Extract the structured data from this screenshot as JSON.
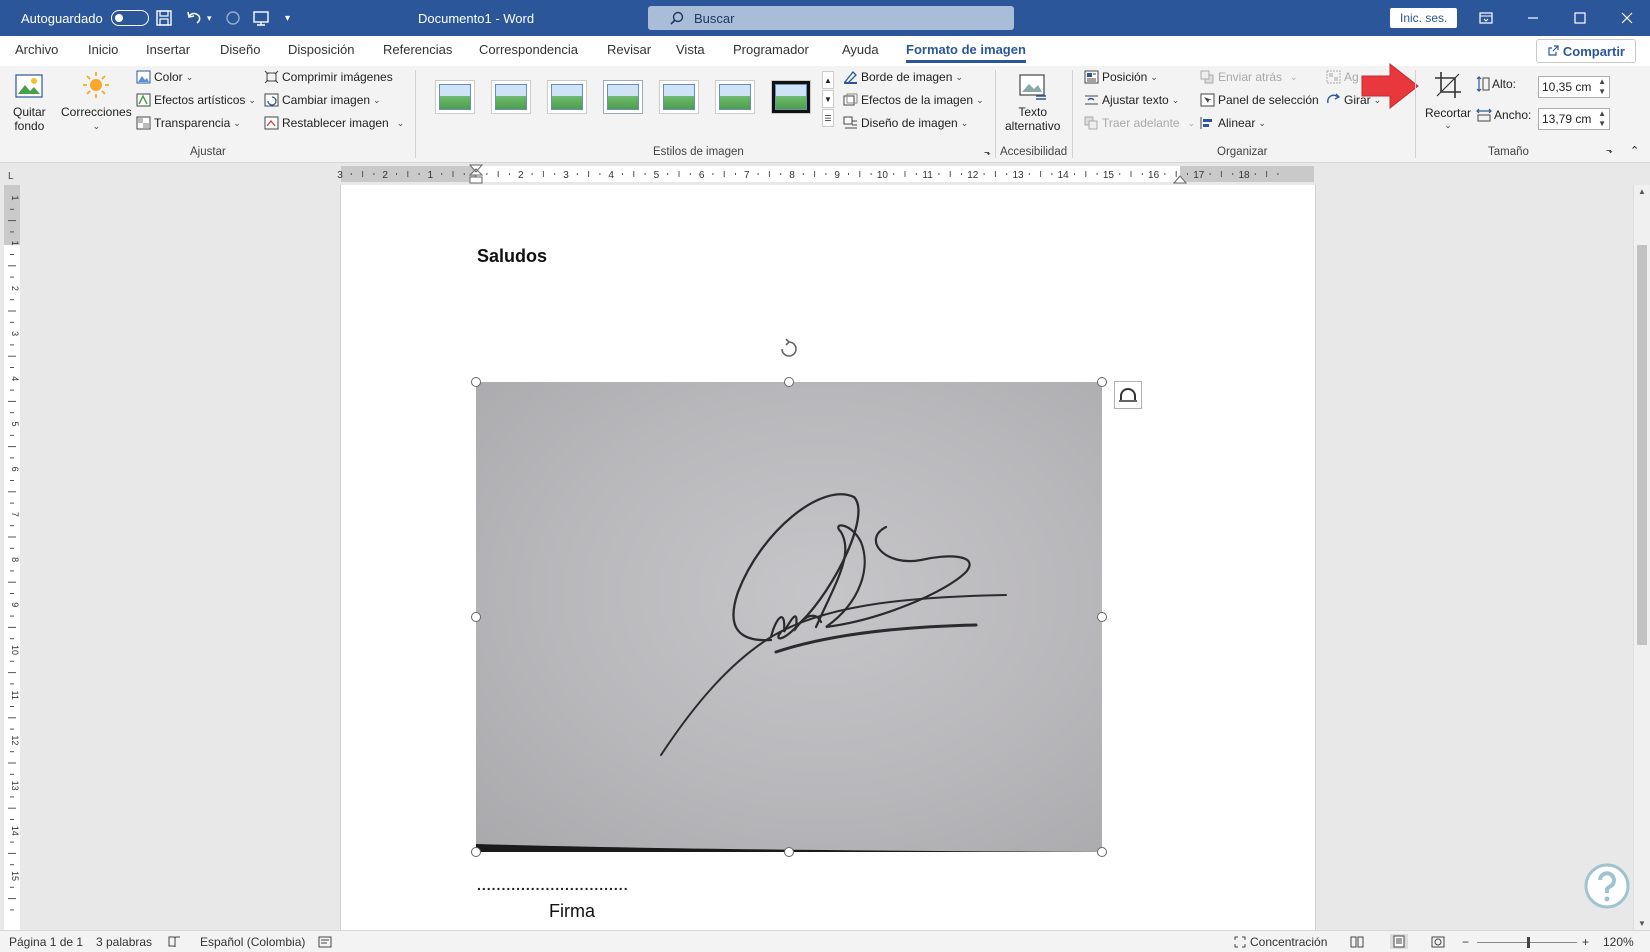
{
  "titlebar": {
    "autosave_label": "Autoguardado",
    "doc_title": "Documento1  -  Word",
    "search_placeholder": "Buscar",
    "signin_label": "Inic. ses."
  },
  "tabs": [
    {
      "label": "Archivo"
    },
    {
      "label": "Inicio"
    },
    {
      "label": "Insertar"
    },
    {
      "label": "Diseño"
    },
    {
      "label": "Disposición"
    },
    {
      "label": "Referencias"
    },
    {
      "label": "Correspondencia"
    },
    {
      "label": "Revisar"
    },
    {
      "label": "Vista"
    },
    {
      "label": "Programador"
    },
    {
      "label": "Ayuda"
    },
    {
      "label": "Formato de imagen"
    }
  ],
  "share_label": "Compartir",
  "ribbon": {
    "ajustar": {
      "quitar_fondo_1": "Quitar",
      "quitar_fondo_2": "fondo",
      "correcciones": "Correcciones",
      "color": "Color",
      "efectos_artisticos": "Efectos artísticos",
      "transparencia": "Transparencia",
      "comprimir": "Comprimir imágenes",
      "cambiar": "Cambiar imagen",
      "restablecer": "Restablecer imagen",
      "label": "Ajustar"
    },
    "estilos": {
      "label": "Estilos de imagen",
      "borde": "Borde de imagen",
      "efectos": "Efectos de la imagen",
      "diseno": "Diseño de imagen"
    },
    "accesibilidad": {
      "texto_1": "Texto",
      "texto_2": "alternativo",
      "label": "Accesibilidad"
    },
    "organizar": {
      "posicion": "Posición",
      "ajustar_texto": "Ajustar texto",
      "traer_adelante": "Traer adelante",
      "enviar_atras": "Enviar atrás",
      "panel_seleccion": "Panel de selección",
      "alinear": "Alinear",
      "agrupar": "Ag",
      "girar": "Girar",
      "label": "Organizar"
    },
    "tamano": {
      "recortar": "Recortar",
      "alto_label": "Alto:",
      "alto_value": "10,35 cm",
      "ancho_label": "Ancho:",
      "ancho_value": "13,79 cm",
      "label": "Tamaño"
    }
  },
  "ruler_labels": [
    "3",
    "2",
    "1",
    "1",
    "2",
    "3",
    "4",
    "5",
    "6",
    "7",
    "8",
    "9",
    "10",
    "11",
    "12",
    "13",
    "14",
    "15",
    "16",
    "17",
    "18"
  ],
  "vruler_labels": [
    "1",
    "1",
    "2",
    "3",
    "4",
    "5",
    "6",
    "7",
    "8",
    "9",
    "10",
    "11",
    "12",
    "13",
    "14",
    "15"
  ],
  "document": {
    "heading": "Saludos",
    "dots": "...............................",
    "firma": "Firma"
  },
  "statusbar": {
    "page": "Página 1 de 1",
    "words": "3 palabras",
    "language": "Español (Colombia)",
    "focus": "Concentración",
    "zoom": "120%"
  },
  "colors": {
    "accent": "#2b579a",
    "arrow": "#e8383d"
  }
}
